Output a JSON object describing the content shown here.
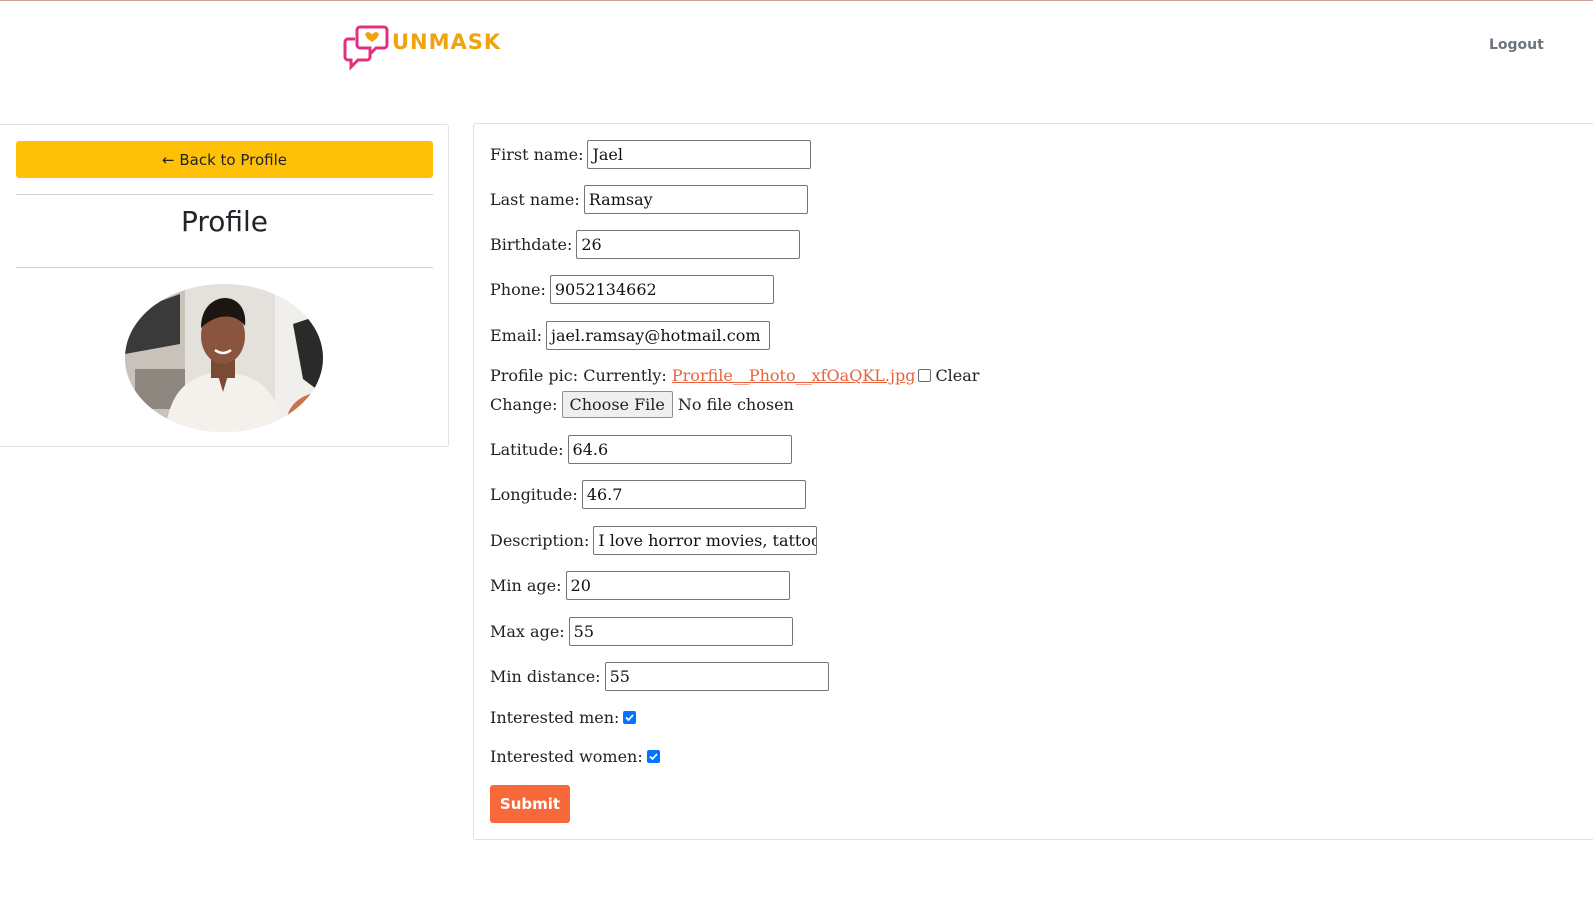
{
  "header": {
    "brand": "UNMASK",
    "logout_label": "Logout",
    "brand_color": "#f0a30a",
    "icon_color": "#e0307f"
  },
  "sidebar": {
    "back_label": "← Back to Profile",
    "title": "Profile",
    "avatar_icon": "profile-photo"
  },
  "form": {
    "first_name": {
      "label": "First name:",
      "value": "Jael"
    },
    "last_name": {
      "label": "Last name:",
      "value": "Ramsay"
    },
    "birthdate": {
      "label": "Birthdate:",
      "value": "26"
    },
    "phone": {
      "label": "Phone:",
      "value": "9052134662"
    },
    "email": {
      "label": "Email:",
      "value": "jael.ramsay@hotmail.com"
    },
    "profile_pic": {
      "label": "Profile pic:",
      "currently": "Currently:",
      "file_link": "Prorfile__Photo__xfOaQKL.jpg",
      "clear_label": "Clear",
      "clear_checked": false,
      "change_label": "Change:",
      "choose_button": "Choose File",
      "no_file": "No file chosen"
    },
    "latitude": {
      "label": "Latitude:",
      "value": "64.6"
    },
    "longitude": {
      "label": "Longitude:",
      "value": "46.7"
    },
    "description": {
      "label": "Description:",
      "value": "I love horror movies, tattoos"
    },
    "min_age": {
      "label": "Min age:",
      "value": "20"
    },
    "max_age": {
      "label": "Max age:",
      "value": "55"
    },
    "min_distance": {
      "label": "Min distance:",
      "value": "55"
    },
    "interested_men": {
      "label": "Interested men:",
      "checked": true
    },
    "interested_women": {
      "label": "Interested women:",
      "checked": true
    },
    "submit_label": "Submit",
    "submit_color": "#f7693a"
  }
}
